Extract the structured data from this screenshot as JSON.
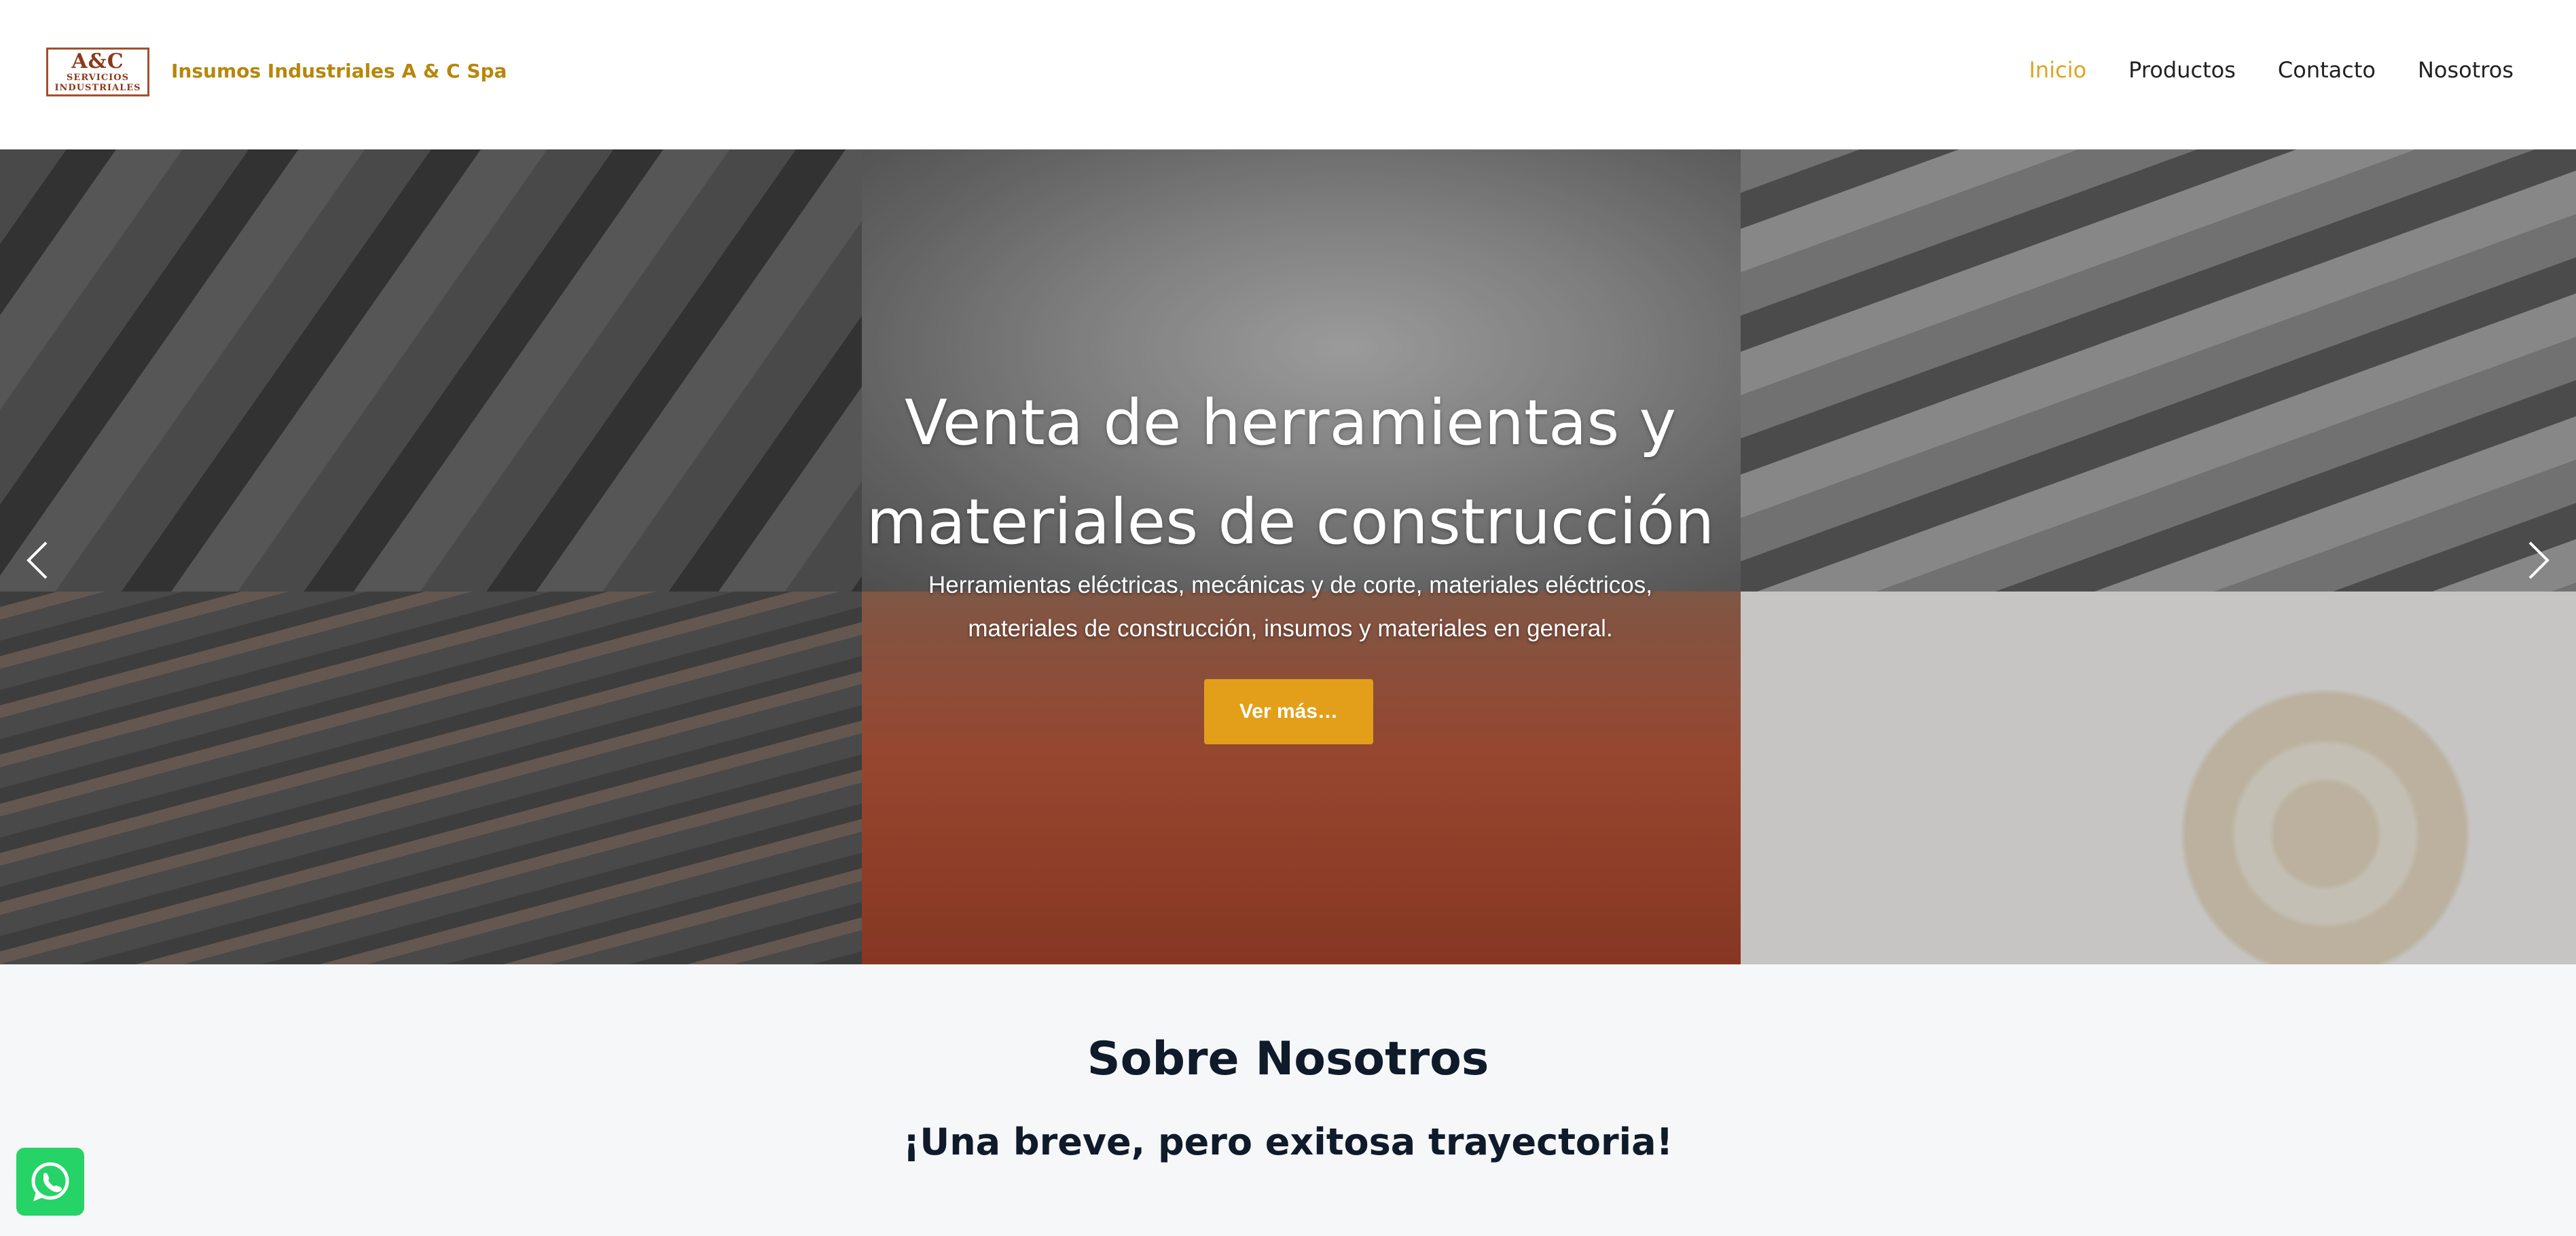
{
  "header": {
    "logo": {
      "line1": "A&C",
      "line2": "SERVICIOS",
      "line3": "INDUSTRIALES"
    },
    "brand": "Insumos Industriales A & C Spa",
    "nav": [
      {
        "label": "Inicio",
        "active": true
      },
      {
        "label": "Productos",
        "active": false
      },
      {
        "label": "Contacto",
        "active": false
      },
      {
        "label": "Nosotros",
        "active": false
      }
    ]
  },
  "hero": {
    "title_line1": "Venta de herramientas y",
    "title_line2": "materiales de construcción",
    "subtitle_line1": "Herramientas eléctricas, mecánicas y de corte, materiales eléctricos,",
    "subtitle_line2": "materiales de construcción, insumos y materiales en general.",
    "button": "Ver más…",
    "prev_icon": "chevron-left-icon",
    "next_icon": "chevron-right-icon"
  },
  "about": {
    "title": "Sobre Nosotros",
    "subtitle": "¡Una breve, pero exitosa trayectoria!"
  },
  "whatsapp": {
    "icon": "whatsapp-icon"
  },
  "colors": {
    "accent": "#e39f1a",
    "brand_text": "#b8860b",
    "heading": "#0f1a2a",
    "whatsapp": "#25d366"
  }
}
